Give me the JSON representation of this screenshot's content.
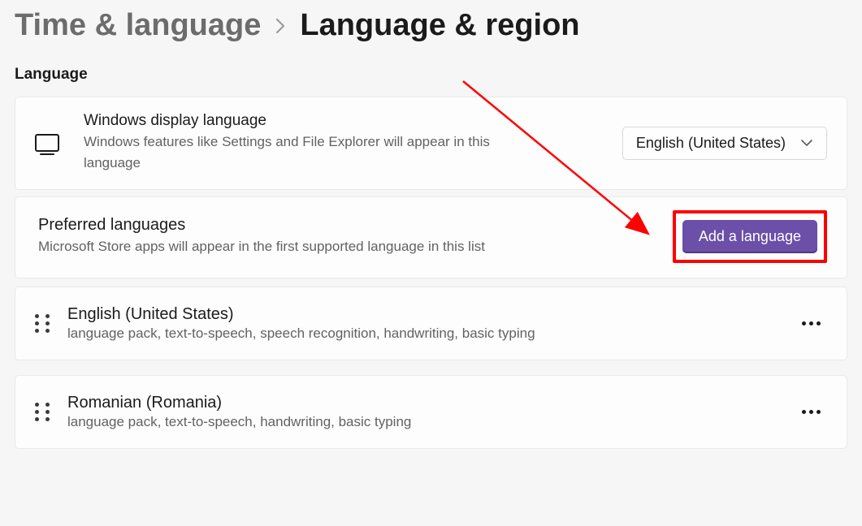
{
  "breadcrumb": {
    "parent": "Time & language",
    "current": "Language & region"
  },
  "section_heading": "Language",
  "display": {
    "title": "Windows display language",
    "subtitle": "Windows features like Settings and File Explorer will appear in this language",
    "dropdown_value": "English (United States)"
  },
  "preferred": {
    "title": "Preferred languages",
    "subtitle": "Microsoft Store apps will appear in the first supported language in this list",
    "add_button": "Add a language"
  },
  "languages": [
    {
      "name": "English (United States)",
      "features": "language pack, text-to-speech, speech recognition, handwriting, basic typing"
    },
    {
      "name": "Romanian (Romania)",
      "features": "language pack, text-to-speech, handwriting, basic typing"
    }
  ],
  "annotation": {
    "highlight_color": "#ff0000"
  }
}
